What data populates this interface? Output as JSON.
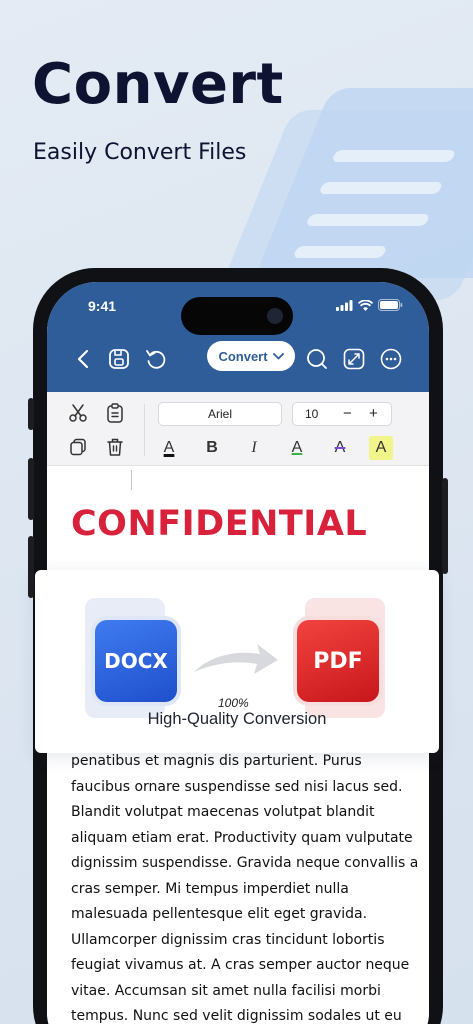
{
  "hero": {
    "title": "Convert",
    "subtitle": "Easily Convert Files"
  },
  "status_bar": {
    "time": "9:41"
  },
  "app_toolbar": {
    "convert_label": "Convert",
    "icons": [
      "back-icon",
      "save-icon",
      "undo-icon",
      "search-icon",
      "fullscreen-icon",
      "more-icon"
    ]
  },
  "ribbon": {
    "font_name": "Ariel",
    "font_size": "10",
    "decrement": "−",
    "increment": "+",
    "format_buttons": [
      "A",
      "B",
      "I",
      "A",
      "A",
      "A"
    ],
    "icons": [
      "scissors-icon",
      "clipboard-icon",
      "copy-icon",
      "trash-icon"
    ]
  },
  "document": {
    "heading": "CONFIDENTIAL",
    "lines": [
      "penatibus et magnis dis parturient. Purus",
      "faucibus ornare suspendisse sed nisi lacus sed.",
      "Blandit volutpat maecenas volutpat blandit",
      "aliquam etiam erat. Productivity quam vulputate",
      "dignissim suspendisse. Gravida neque convallis a",
      "cras semper. Mi tempus imperdiet nulla",
      "malesuada pellentesque elit eget gravida.",
      "Ullamcorper dignissim cras tincidunt lobortis",
      "feugiat vivamus at. A cras semper auctor neque",
      "vitae. Accumsan sit amet nulla facilisi morbi",
      "tempus. Nunc sed velit dignissim sodales ut eu"
    ]
  },
  "conversion": {
    "from_format": "DOCX",
    "to_format": "PDF",
    "progress": "100%",
    "label": "High-Quality Conversion"
  },
  "colors": {
    "appbar": "#2f5d99",
    "heading_red": "#d8213b",
    "docx_blue": "#2458d6",
    "pdf_red": "#dc2a2a",
    "hero_text": "#0d1330"
  }
}
